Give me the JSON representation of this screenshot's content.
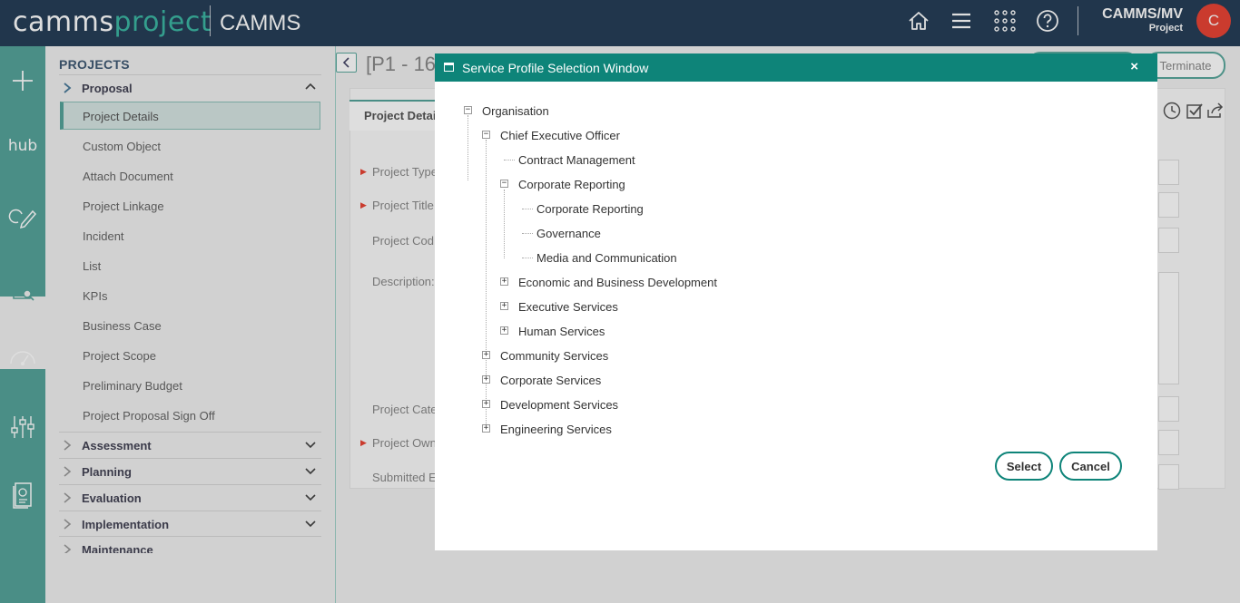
{
  "header": {
    "logo_prefix": "camms",
    "logo_suffix": "project",
    "brand": "CAMMS",
    "user_name": "CAMMS/MV",
    "user_role": "Project",
    "avatar_letter": "C",
    "icons": [
      "home-icon",
      "menu-icon",
      "apps-grid-icon",
      "help-icon"
    ]
  },
  "rail": {
    "hub_label": "hub"
  },
  "sidenav": {
    "title": "PROJECTS",
    "groups": [
      {
        "label": "Proposal",
        "expanded": true
      },
      {
        "label": "Assessment"
      },
      {
        "label": "Planning"
      },
      {
        "label": "Evaluation"
      },
      {
        "label": "Implementation"
      },
      {
        "label": "Maintenance"
      }
    ],
    "items": [
      "Project Details",
      "Custom Object",
      "Attach Document",
      "Project Linkage",
      "Incident",
      "List",
      "KPIs",
      "Business Case",
      "Project Scope",
      "Preliminary Budget",
      "Project Proposal Sign Off"
    ]
  },
  "main": {
    "page_title": "[P1 - 16",
    "terminate_label": "Terminate",
    "tab_label": "Project Detail",
    "labels": [
      "Project Type",
      "Project Title",
      "Project Cod",
      "Description:",
      "Project Cate",
      "Project Own",
      "Submitted E"
    ]
  },
  "modal": {
    "title": "Service Profile Selection Window",
    "close_label": "×",
    "tree": {
      "root": "Organisation",
      "ceo": "Chief Executive Officer",
      "contract_management": "Contract Management",
      "corporate_reporting": "Corporate Reporting",
      "cr_child_1": "Corporate Reporting",
      "cr_child_2": "Governance",
      "cr_child_3": "Media and Communication",
      "economic": "Economic and Business Development",
      "executive": "Executive Services",
      "human": "Human Services",
      "community": "Community Services",
      "corporate_services": "Corporate Services",
      "development": "Development Services",
      "engineering": "Engineering Services"
    },
    "select_label": "Select",
    "cancel_label": "Cancel"
  },
  "colors": {
    "topbar": "#263f58",
    "teal": "#56a49a",
    "modal_header": "#0e8479",
    "avatar": "#e94435"
  }
}
